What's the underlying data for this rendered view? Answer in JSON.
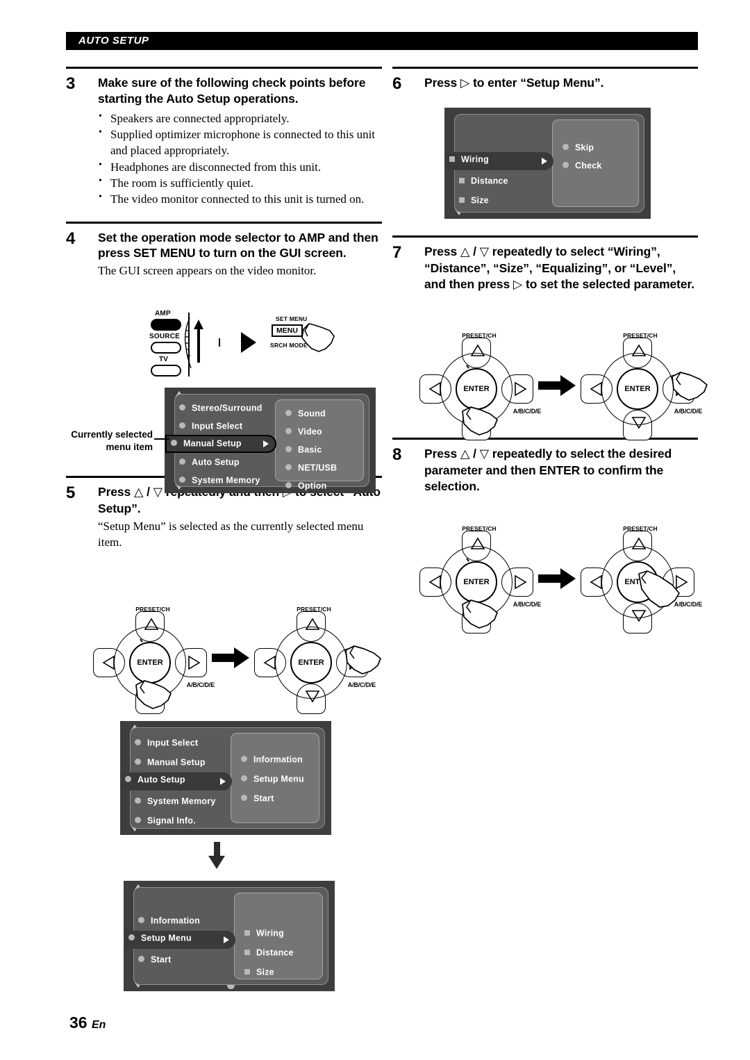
{
  "header": {
    "title": "AUTO SETUP"
  },
  "footer": {
    "page": "36",
    "lang": "En"
  },
  "steps": {
    "s3": {
      "num": "3",
      "heading": "Make sure of the following check points before starting the Auto Setup operations.",
      "checks": [
        "Speakers are connected appropriately.",
        "Supplied optimizer microphone is connected to this unit and placed appropriately.",
        "Headphones are disconnected from this unit.",
        "The room is sufficiently quiet.",
        "The video monitor connected to this unit is turned on."
      ]
    },
    "s4": {
      "num": "4",
      "heading": "Set the operation mode selector to AMP and then press SET MENU to turn on the GUI screen.",
      "body": "The GUI screen appears on the video monitor."
    },
    "s5": {
      "num": "5",
      "heading_pre": "Press ",
      "heading_up": "△",
      "heading_sep": " / ",
      "heading_dn": "▽",
      "heading_mid": " repeatedly and then ",
      "heading_rt": "▷",
      "heading_post": " to select “Auto Setup”.",
      "body": "“Setup Menu” is selected as the currently selected menu item."
    },
    "s6": {
      "num": "6",
      "heading_pre": "Press ",
      "heading_rt": "▷",
      "heading_post": " to enter “Setup Menu”."
    },
    "s7": {
      "num": "7",
      "heading_pre": "Press ",
      "heading_up": "△",
      "heading_sep": " / ",
      "heading_dn": "▽",
      "heading_mid": " repeatedly to select “Wiring”, “Distance”, “Size”, “Equalizing”, or “Level”, and then press ",
      "heading_rt": "▷",
      "heading_post": " to set the selected parameter."
    },
    "s8": {
      "num": "8",
      "heading_pre": "Press ",
      "heading_up": "△",
      "heading_sep": " / ",
      "heading_dn": "▽",
      "heading_post": " repeatedly to select the desired parameter and then ENTER to confirm the selection."
    }
  },
  "callout": {
    "text": "Currently selected menu item"
  },
  "amp_figure": {
    "mode_labels": {
      "amp": "AMP",
      "source": "SOURCE",
      "tv": "TV"
    },
    "set_menu_top": "SET MENU",
    "menu_button": "MENU",
    "set_menu_bottom": "SRCH MODE"
  },
  "remote": {
    "preset_label": "PRESET/CH",
    "abcde_label": "A/B/C/D/E",
    "enter_label": "ENTER"
  },
  "gui_screens": {
    "screen1": {
      "left_items": [
        "Stereo/Surround",
        "Input Select",
        "Manual Setup",
        "Auto Setup",
        "System Memory"
      ],
      "selected_left": "Manual Setup",
      "right_items": [
        "Sound",
        "Video",
        "Basic",
        "NET/USB",
        "Option"
      ]
    },
    "screen2": {
      "left_items": [
        "Input Select",
        "Manual Setup",
        "Auto Setup",
        "System Memory",
        "Signal Info."
      ],
      "selected_left": "Auto Setup",
      "right_items": [
        "Information",
        "Setup Menu",
        "Start"
      ]
    },
    "screen3": {
      "left_items": [
        "Information",
        "Setup Menu",
        "Start"
      ],
      "selected_left": "Setup Menu",
      "right_items": [
        "Wiring",
        "Distance",
        "Size"
      ]
    },
    "screen4": {
      "left_items": [
        "Wiring",
        "Distance",
        "Size"
      ],
      "selected_left": "Wiring",
      "right_items": [
        "Skip",
        "Check"
      ]
    }
  },
  "colors": {
    "gui_frame": "#3e3e3e",
    "gui_left_pane": "#5b5b5b",
    "gui_right_pane": "#757575",
    "gui_selected": "#3a3a3a",
    "header_bg": "#000000"
  }
}
